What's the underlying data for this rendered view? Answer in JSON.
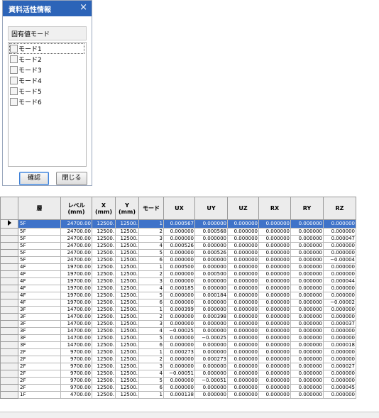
{
  "dialog": {
    "title": "資料活性情報",
    "close_glyph": "×",
    "mode_field_value": "固有値モード",
    "modes": [
      "モード1",
      "モード2",
      "モード3",
      "モード4",
      "モード5",
      "モード6"
    ],
    "confirm_label": "確認",
    "close_label": "閉じる"
  },
  "table": {
    "headers": {
      "level": "層",
      "elev": "レベル\n(mm)",
      "x": "X\n(mm)",
      "y": "Y\n(mm)",
      "mode": "モード",
      "ux": "UX",
      "uy": "UY",
      "uz": "UZ",
      "rx": "RX",
      "ry": "RY",
      "rz": "RZ"
    },
    "selected_row_index": 0,
    "rows": [
      [
        "5F",
        "24700.00",
        "12500.",
        "12500.",
        "1",
        "0.000567",
        "0.000000",
        "0.000000",
        "0.000000",
        "0.000000",
        "0.000000"
      ],
      [
        "5F",
        "24700.00",
        "12500.",
        "12500.",
        "2",
        "0.000000",
        "0.000568",
        "0.000000",
        "0.000000",
        "0.000000",
        "0.000000"
      ],
      [
        "5F",
        "24700.00",
        "12500.",
        "12500.",
        "3",
        "0.000000",
        "0.000000",
        "0.000000",
        "0.000000",
        "0.000000",
        "0.000047"
      ],
      [
        "5F",
        "24700.00",
        "12500.",
        "12500.",
        "4",
        "0.000526",
        "0.000000",
        "0.000000",
        "0.000000",
        "0.000000",
        "0.000000"
      ],
      [
        "5F",
        "24700.00",
        "12500.",
        "12500.",
        "5",
        "0.000000",
        "0.000526",
        "0.000000",
        "0.000000",
        "0.000000",
        "0.000000"
      ],
      [
        "5F",
        "24700.00",
        "12500.",
        "12500.",
        "6",
        "0.000000",
        "0.000000",
        "0.000000",
        "0.000000",
        "0.000000",
        "−0.00004"
      ],
      [
        "4F",
        "19700.00",
        "12500.",
        "12500.",
        "1",
        "0.000500",
        "0.000000",
        "0.000000",
        "0.000000",
        "0.000000",
        "0.000000"
      ],
      [
        "4F",
        "19700.00",
        "12500.",
        "12500.",
        "2",
        "0.000000",
        "0.000500",
        "0.000000",
        "0.000000",
        "0.000000",
        "0.000000"
      ],
      [
        "4F",
        "19700.00",
        "12500.",
        "12500.",
        "3",
        "0.000000",
        "0.000000",
        "0.000000",
        "0.000000",
        "0.000000",
        "0.000044"
      ],
      [
        "4F",
        "19700.00",
        "12500.",
        "12500.",
        "4",
        "0.000185",
        "0.000000",
        "0.000000",
        "0.000000",
        "0.000000",
        "0.000000"
      ],
      [
        "4F",
        "19700.00",
        "12500.",
        "12500.",
        "5",
        "0.000000",
        "0.000184",
        "0.000000",
        "0.000000",
        "0.000000",
        "0.000000"
      ],
      [
        "4F",
        "19700.00",
        "12500.",
        "12500.",
        "6",
        "0.000000",
        "0.000000",
        "0.000000",
        "0.000000",
        "0.000000",
        "−0.00002"
      ],
      [
        "3F",
        "14700.00",
        "12500.",
        "12500.",
        "1",
        "0.000399",
        "0.000000",
        "0.000000",
        "0.000000",
        "0.000000",
        "0.000000"
      ],
      [
        "3F",
        "14700.00",
        "12500.",
        "12500.",
        "2",
        "0.000000",
        "0.000398",
        "0.000000",
        "0.000000",
        "0.000000",
        "0.000000"
      ],
      [
        "3F",
        "14700.00",
        "12500.",
        "12500.",
        "3",
        "0.000000",
        "0.000000",
        "0.000000",
        "0.000000",
        "0.000000",
        "0.000037"
      ],
      [
        "3F",
        "14700.00",
        "12500.",
        "12500.",
        "4",
        "−0.00025",
        "0.000000",
        "0.000000",
        "0.000000",
        "0.000000",
        "0.000000"
      ],
      [
        "3F",
        "14700.00",
        "12500.",
        "12500.",
        "5",
        "0.000000",
        "−0.00025",
        "0.000000",
        "0.000000",
        "0.000000",
        "0.000000"
      ],
      [
        "3F",
        "14700.00",
        "12500.",
        "12500.",
        "6",
        "0.000000",
        "0.000000",
        "0.000000",
        "0.000000",
        "0.000000",
        "0.000018"
      ],
      [
        "2F",
        "9700.00",
        "12500.",
        "12500.",
        "1",
        "0.000273",
        "0.000000",
        "0.000000",
        "0.000000",
        "0.000000",
        "0.000000"
      ],
      [
        "2F",
        "9700.00",
        "12500.",
        "12500.",
        "2",
        "0.000000",
        "0.000273",
        "0.000000",
        "0.000000",
        "0.000000",
        "0.000000"
      ],
      [
        "2F",
        "9700.00",
        "12500.",
        "12500.",
        "3",
        "0.000000",
        "0.000000",
        "0.000000",
        "0.000000",
        "0.000000",
        "0.000027"
      ],
      [
        "2F",
        "9700.00",
        "12500.",
        "12500.",
        "4",
        "−0.00051",
        "0.000000",
        "0.000000",
        "0.000000",
        "0.000000",
        "0.000000"
      ],
      [
        "2F",
        "9700.00",
        "12500.",
        "12500.",
        "5",
        "0.000000",
        "−0.00051",
        "0.000000",
        "0.000000",
        "0.000000",
        "0.000000"
      ],
      [
        "2F",
        "9700.00",
        "12500.",
        "12500.",
        "6",
        "0.000000",
        "0.000000",
        "0.000000",
        "0.000000",
        "0.000000",
        "0.000045"
      ],
      [
        "1F",
        "4700.00",
        "12500.",
        "12500.",
        "1",
        "0.000138",
        "0.000000",
        "0.000000",
        "0.000000",
        "0.000000",
        "0.000000"
      ]
    ]
  }
}
